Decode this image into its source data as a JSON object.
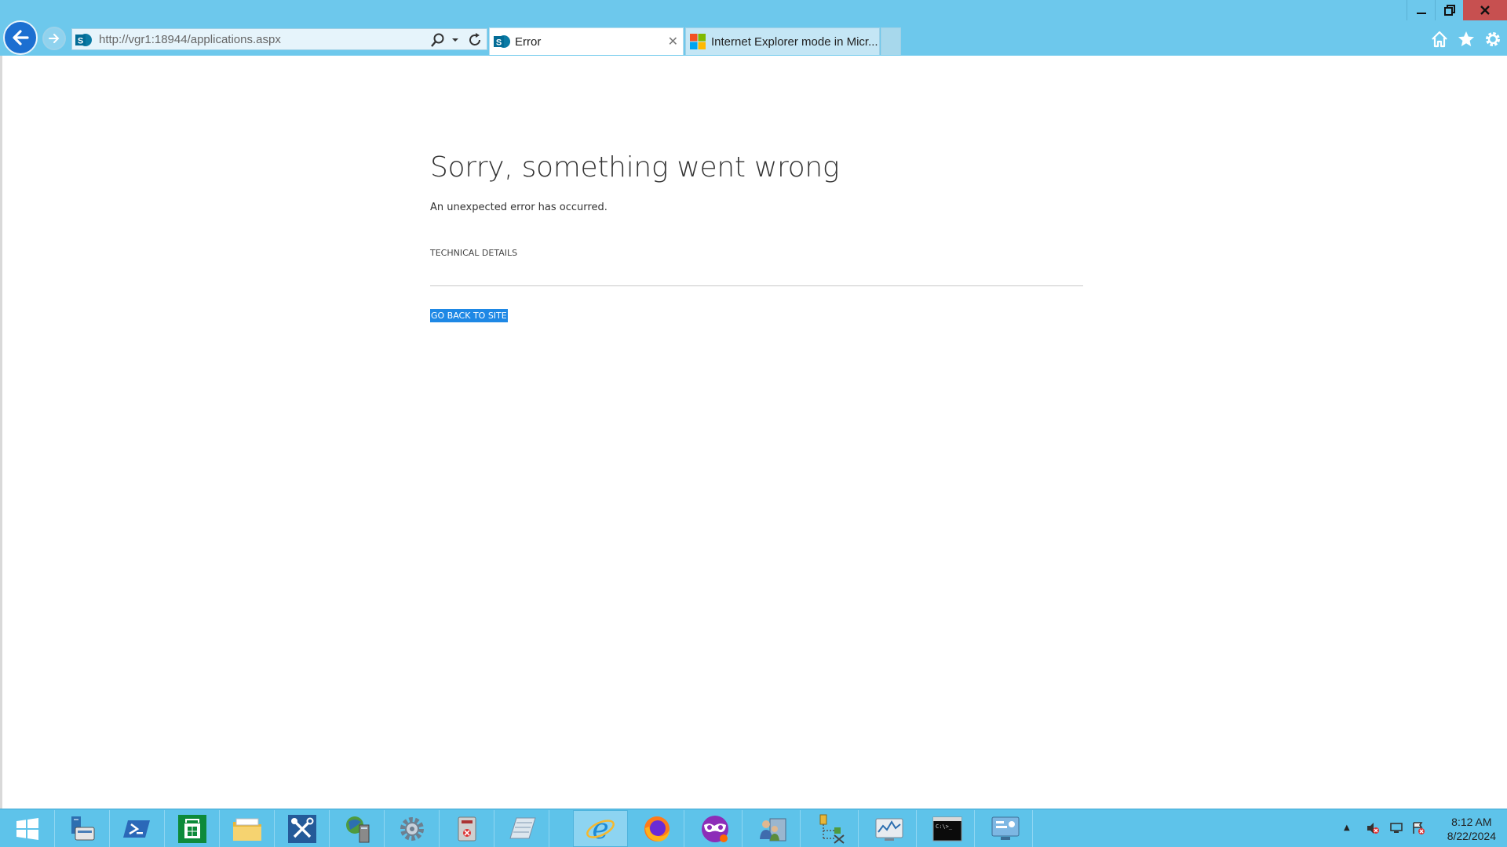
{
  "browser": {
    "address_url": "http://vgr1:18944/applications.aspx",
    "tabs": [
      {
        "label": "Error",
        "active": true
      },
      {
        "label": "Internet Explorer mode in Micr...",
        "active": false
      }
    ],
    "window_controls": [
      "minimize-icon",
      "restore-icon",
      "close-icon"
    ],
    "toolbar_icons": [
      "home-icon",
      "star-icon",
      "gear-icon"
    ]
  },
  "page": {
    "title": "Sorry, something went wrong",
    "message": "An unexpected error has occurred.",
    "technical_details_label": "TECHNICAL DETAILS",
    "go_back_label": "GO BACK TO SITE"
  },
  "taskbar": {
    "items": [
      "start-icon",
      "server-manager-icon",
      "powershell-icon",
      "store-icon",
      "file-explorer-icon",
      "tools-icon",
      "network-icon",
      "settings-icon",
      "security-icon",
      "notepad-icon",
      "internet-explorer-icon",
      "firefox-icon",
      "mask-icon",
      "users-icon",
      "tree-icon",
      "performance-icon",
      "cmd-icon",
      "control-panel-icon"
    ],
    "active_item": "internet-explorer-icon",
    "clock_time": "8:12 AM",
    "clock_date": "8/22/2024"
  },
  "colors": {
    "chrome_bg": "#6dc8ec",
    "accent": "#1e88e5",
    "close_button": "#c75050"
  }
}
